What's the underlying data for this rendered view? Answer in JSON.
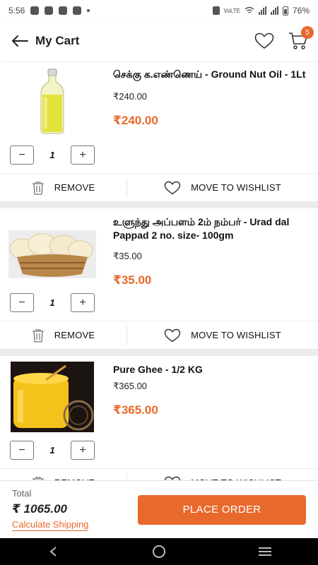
{
  "status_bar": {
    "time": "5:56",
    "battery": "76%",
    "network_label": "VoLTE"
  },
  "header": {
    "title": "My Cart",
    "cart_count": "5"
  },
  "items": [
    {
      "name": "செக்கு க.எண்ணெய் - Ground Nut Oil - 1Lt",
      "mrp": "₹240.00",
      "price": "₹240.00",
      "qty": "1",
      "image": "groundnut-oil-bottle"
    },
    {
      "name": "உளுந்து அப்பளம் 2ம் நம்பர் - Urad dal Pappad 2 no. size- 100gm",
      "mrp": "₹35.00",
      "price": "₹35.00",
      "qty": "1",
      "image": "pappad-basket"
    },
    {
      "name": "Pure Ghee - 1/2 KG",
      "mrp": "₹365.00",
      "price": "₹365.00",
      "qty": "1",
      "image": "ghee-jar"
    }
  ],
  "actions": {
    "remove": "REMOVE",
    "wishlist": "MOVE TO WISHLIST"
  },
  "qty_controls": {
    "minus": "−",
    "plus": "+"
  },
  "footer": {
    "total_label": "Total",
    "total_value": "₹ 1065.00",
    "calc_shipping": "Calculate Shipping",
    "place_order": "PLACE ORDER"
  },
  "colors": {
    "accent": "#e8692c",
    "nav_bg": "#000000"
  }
}
